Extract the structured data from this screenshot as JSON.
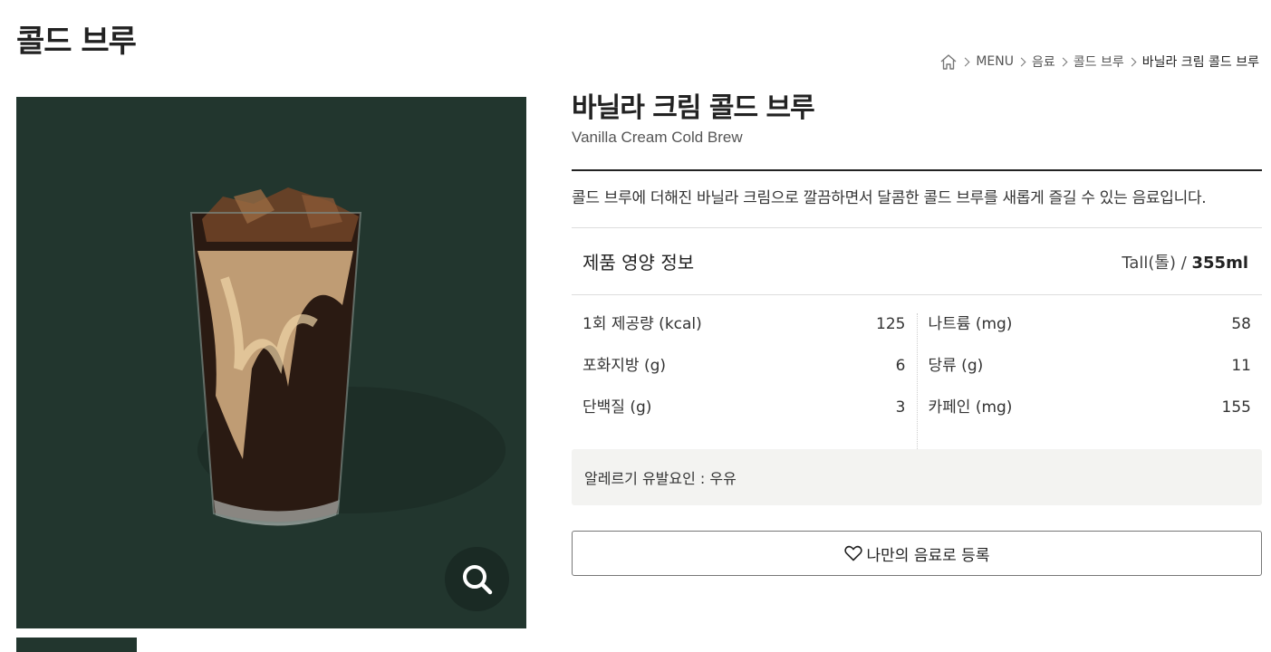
{
  "header": {
    "category_title": "콜드 브루"
  },
  "breadcrumb": {
    "home_icon": "home-icon",
    "items": [
      "MENU",
      "음료",
      "콜드 브루",
      "바닐라 크림 콜드 브루"
    ]
  },
  "product": {
    "name_ko": "바닐라 크림 콜드 브루",
    "name_en": "Vanilla Cream Cold Brew",
    "description": "콜드 브루에 더해진 바닐라 크림으로 깔끔하면서 달콤한 콜드 브루를 새롭게 즐길 수 있는 음료입니다.",
    "image_bg_color": "#22362e",
    "zoom_icon": "magnifier-icon"
  },
  "nutrition": {
    "title": "제품 영양 정보",
    "size_label": "Tall(톨) / ",
    "size_volume": "355ml",
    "left": [
      {
        "label": "1회 제공량 (kcal)",
        "value": "125"
      },
      {
        "label": "포화지방 (g)",
        "value": "6"
      },
      {
        "label": "단백질 (g)",
        "value": "3"
      }
    ],
    "right": [
      {
        "label": "나트륨 (mg)",
        "value": "58"
      },
      {
        "label": "당류 (g)",
        "value": "11"
      },
      {
        "label": "카페인 (mg)",
        "value": "155"
      }
    ]
  },
  "allergy": {
    "text": "알레르기 유발요인 : 우유"
  },
  "favorite": {
    "label": "나만의 음료로 등록",
    "icon": "heart-icon"
  }
}
